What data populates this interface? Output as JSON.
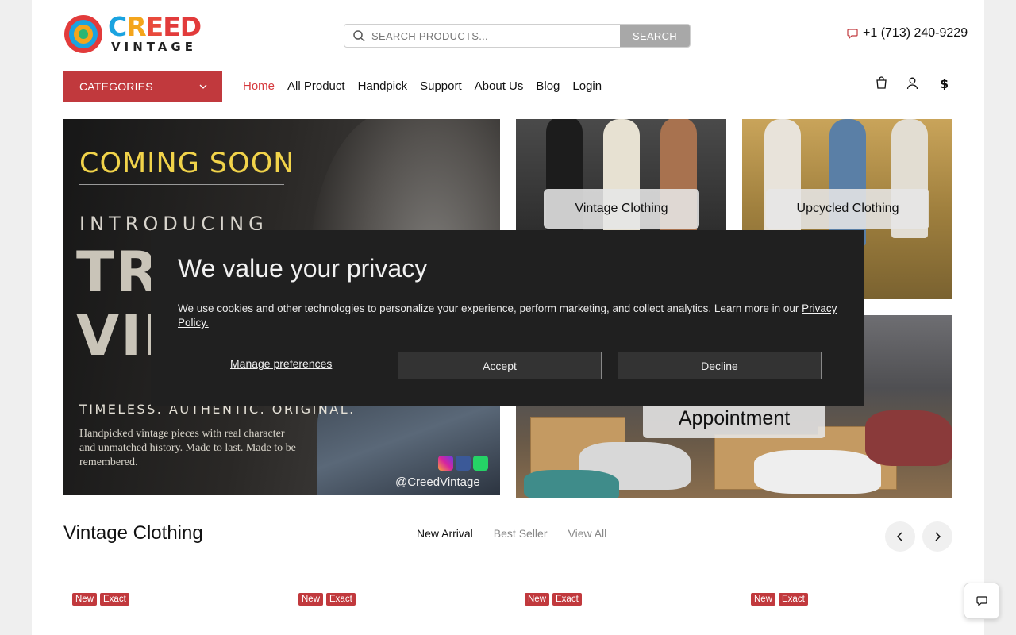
{
  "brand": {
    "logo_top": "CREED",
    "logo_bottom": "VINTAGE"
  },
  "search": {
    "placeholder": "SEARCH PRODUCTS...",
    "button_label": "SEARCH"
  },
  "contact": {
    "phone": "+1 (713) 240-9229"
  },
  "nav": {
    "categories_label": "CATEGORIES",
    "items": [
      "Home",
      "All Product",
      "Handpick",
      "Support",
      "About Us",
      "Blog",
      "Login"
    ],
    "active": "Home"
  },
  "hero": {
    "coming": "COMING SOON",
    "introducing": "INTRODUCING",
    "big_line1": "TRU",
    "big_line2": "VIN",
    "tagline": "TIMELESS. AUTHENTIC. ORIGINAL.",
    "desc": "Handpicked vintage pieces with real character and unmatched history. Made to last. Made to be remembered.",
    "handle": "@CreedVintage"
  },
  "tiles": {
    "tile1_label": "Vintage Clothing",
    "tile2_label": "Upcycled Clothing",
    "tile3_label": "Appointment"
  },
  "privacy": {
    "title": "We value your privacy",
    "text": "We use cookies and other technologies to personalize your experience, perform marketing, and collect analytics. Learn more in our ",
    "link": "Privacy Policy.",
    "manage": "Manage preferences",
    "accept": "Accept",
    "decline": "Decline"
  },
  "section": {
    "title": "Vintage Clothing",
    "tabs": [
      "New Arrival",
      "Best Seller",
      "View All"
    ],
    "active_tab": "New Arrival"
  },
  "products": [
    {
      "badges": [
        "New",
        "Exact"
      ]
    },
    {
      "badges": [
        "New",
        "Exact"
      ]
    },
    {
      "badges": [
        "New",
        "Exact"
      ]
    },
    {
      "badges": [
        "New",
        "Exact"
      ]
    }
  ],
  "colors": {
    "accent": "#c1393d",
    "modal_bg": "#202020"
  }
}
